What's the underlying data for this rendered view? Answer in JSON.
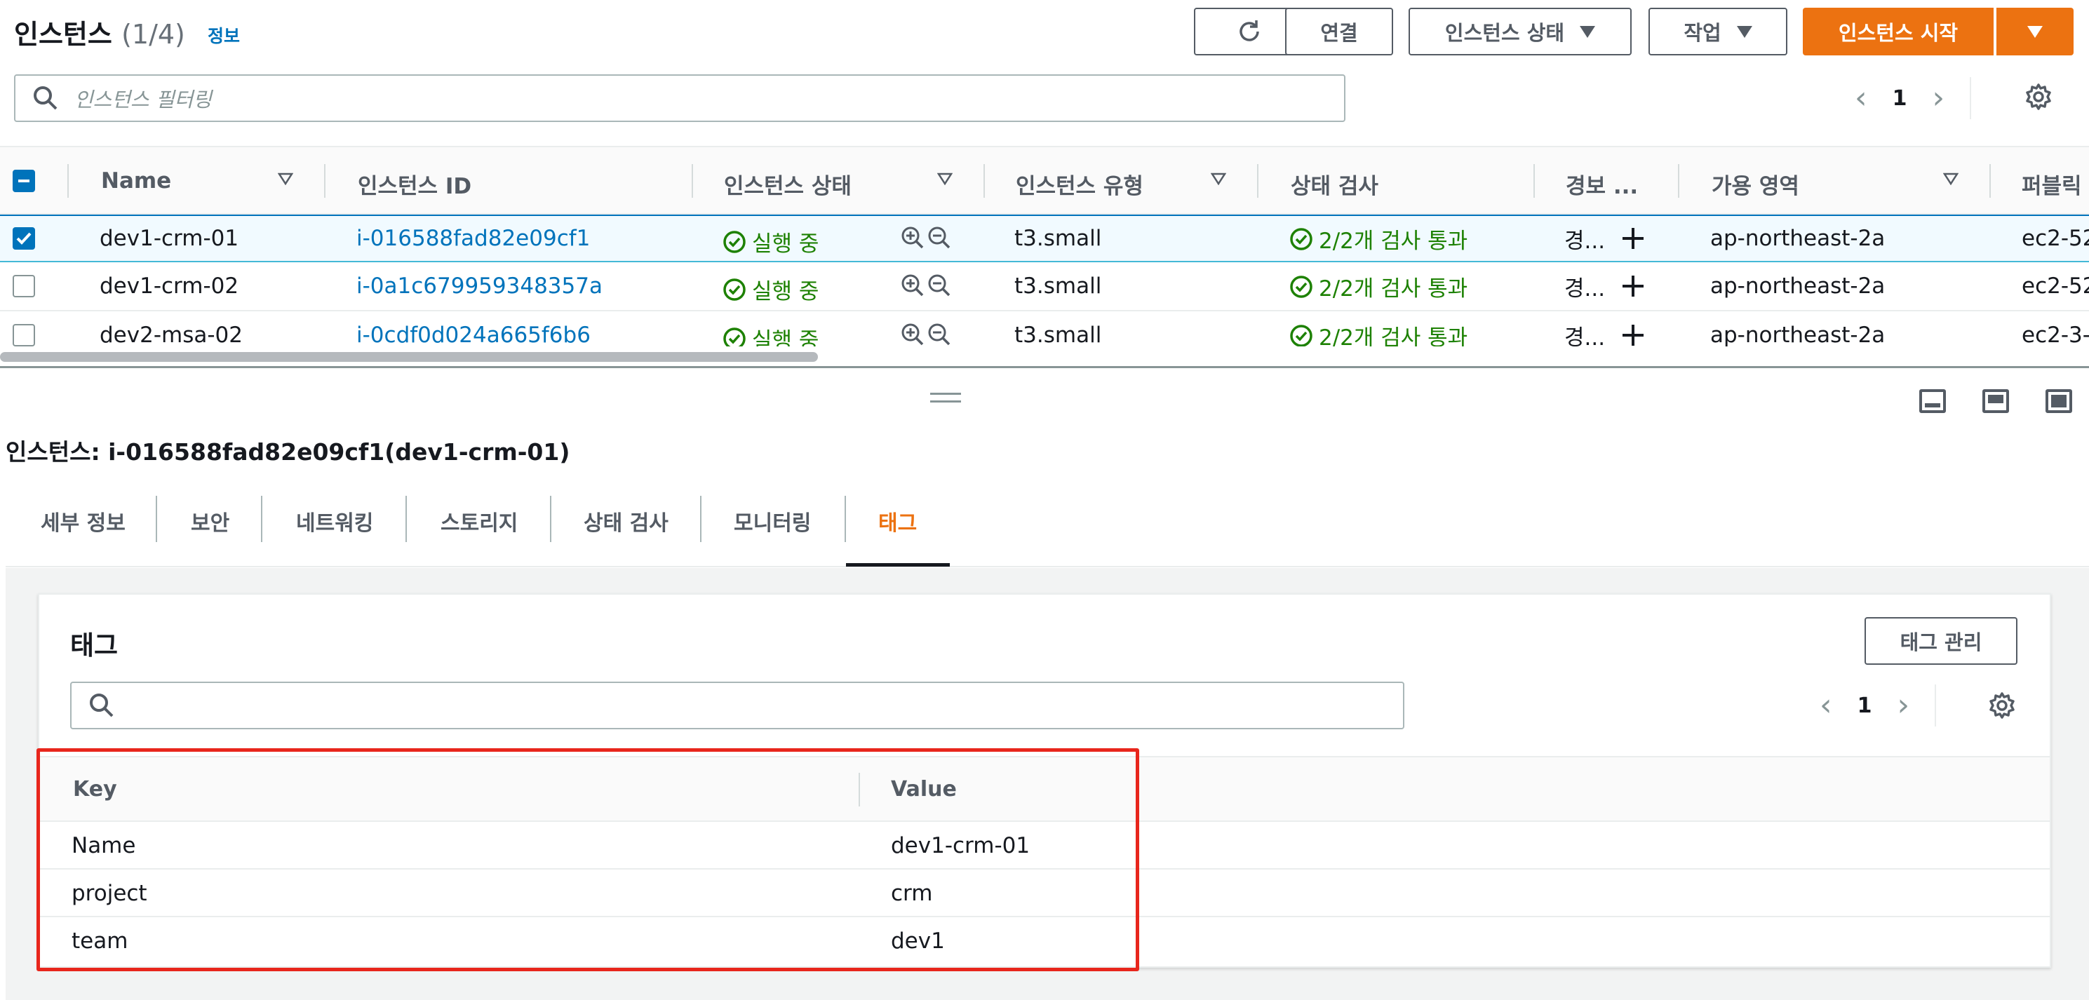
{
  "header": {
    "title": "인스턴스",
    "count": "(1/4)",
    "info_link": "정보",
    "refresh_label": "",
    "connect_label": "연결",
    "instance_state_label": "인스턴스 상태",
    "actions_label": "작업",
    "launch_label": "인스턴스 시작",
    "search_placeholder": "인스턴스 필터링",
    "page": "1"
  },
  "table": {
    "columns": [
      "Name",
      "인스턴스 ID",
      "인스턴스 상태",
      "인스턴스 유형",
      "상태 검사",
      "경보 ...",
      "가용 영역",
      "퍼블릭"
    ],
    "rows": [
      {
        "selected": true,
        "name": "dev1-crm-01",
        "id": "i-016588fad82e09cf1",
        "state": "실행 중",
        "type": "t3.small",
        "check": "2/2개 검사 통과",
        "alarm": "경...",
        "az": "ap-northeast-2a",
        "public": "ec2-52"
      },
      {
        "selected": false,
        "name": "dev1-crm-02",
        "id": "i-0a1c679959348357a",
        "state": "실행 중",
        "type": "t3.small",
        "check": "2/2개 검사 통과",
        "alarm": "경...",
        "az": "ap-northeast-2a",
        "public": "ec2-52"
      },
      {
        "selected": false,
        "name": "dev2-msa-02",
        "id": "i-0cdf0d024a665f6b6",
        "state": "실행 중",
        "type": "t3.small",
        "check": "2/2개 검사 통과",
        "alarm": "경...",
        "az": "ap-northeast-2a",
        "public": "ec2-3-"
      }
    ]
  },
  "detail": {
    "title": "인스턴스: i-016588fad82e09cf1(dev1-crm-01)",
    "tabs": [
      "세부 정보",
      "보안",
      "네트워킹",
      "스토리지",
      "상태 검사",
      "모니터링",
      "태그"
    ],
    "active_tab": "태그"
  },
  "tags_panel": {
    "title": "태그",
    "manage_label": "태그 관리",
    "search_placeholder": "",
    "page": "1",
    "columns": [
      "Key",
      "Value"
    ],
    "rows": [
      {
        "key": "Name",
        "value": "dev1-crm-01"
      },
      {
        "key": "project",
        "value": "crm"
      },
      {
        "key": "team",
        "value": "dev1"
      }
    ]
  },
  "colors": {
    "primary": "#ec7211",
    "link": "#0073bb",
    "success": "#1d8102",
    "highlight": "#e8261c"
  }
}
